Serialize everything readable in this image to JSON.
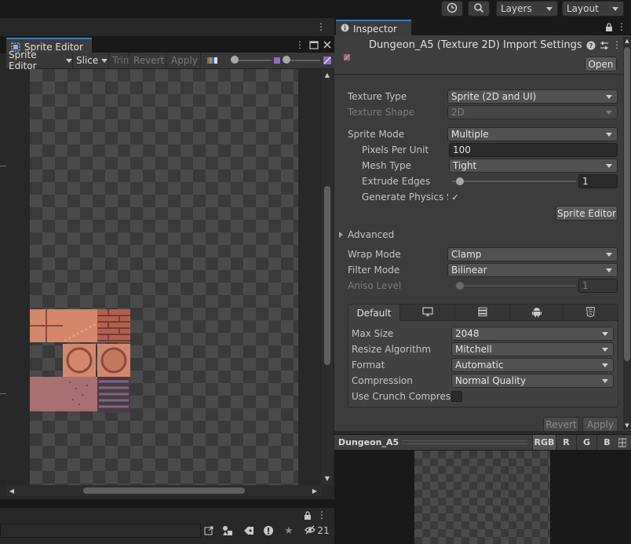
{
  "toolbar": {
    "layers_label": "Layers",
    "layout_label": "Layout"
  },
  "sprite_editor": {
    "tab_label": "Sprite Editor",
    "menu_label": "Sprite Editor",
    "slice_label": "Slice",
    "trim_label": "Trim",
    "revert_label": "Revert",
    "apply_label": "Apply"
  },
  "bottom_panel": {
    "count_label": "21"
  },
  "inspector": {
    "tab_label": "Inspector",
    "title": "Dungeon_A5 (Texture 2D) Import Settings",
    "open_label": "Open",
    "texture_type": {
      "label": "Texture Type",
      "value": "Sprite (2D and UI)"
    },
    "texture_shape": {
      "label": "Texture Shape",
      "value": "2D"
    },
    "sprite_mode": {
      "label": "Sprite Mode",
      "value": "Multiple"
    },
    "pixels_per_unit": {
      "label": "Pixels Per Unit",
      "value": "100"
    },
    "mesh_type": {
      "label": "Mesh Type",
      "value": "Tight"
    },
    "extrude_edges": {
      "label": "Extrude Edges",
      "value": "1",
      "slider_fraction": 0.03
    },
    "generate_physics": {
      "label": "Generate Physics S",
      "checked": "✓"
    },
    "sprite_editor_button": "Sprite Editor",
    "advanced_label": "Advanced",
    "wrap_mode": {
      "label": "Wrap Mode",
      "value": "Clamp"
    },
    "filter_mode": {
      "label": "Filter Mode",
      "value": "Bilinear"
    },
    "aniso_level": {
      "label": "Aniso Level",
      "value": "1"
    },
    "platform": {
      "default_tab": "Default",
      "max_size": {
        "label": "Max Size",
        "value": "2048"
      },
      "resize_algorithm": {
        "label": "Resize Algorithm",
        "value": "Mitchell"
      },
      "format": {
        "label": "Format",
        "value": "Automatic"
      },
      "compression": {
        "label": "Compression",
        "value": "Normal Quality"
      },
      "use_crunch": {
        "label": "Use Crunch Compress"
      }
    },
    "revert_label": "Revert",
    "apply_label": "Apply"
  },
  "preview": {
    "name": "Dungeon_A5",
    "channels": [
      "RGB",
      "R",
      "G",
      "B"
    ]
  },
  "colors": {
    "accent": "#3a79bb",
    "tile_light": "#d4876a",
    "tile_dark": "#8a4a42",
    "tile_pink": "#a87070"
  }
}
